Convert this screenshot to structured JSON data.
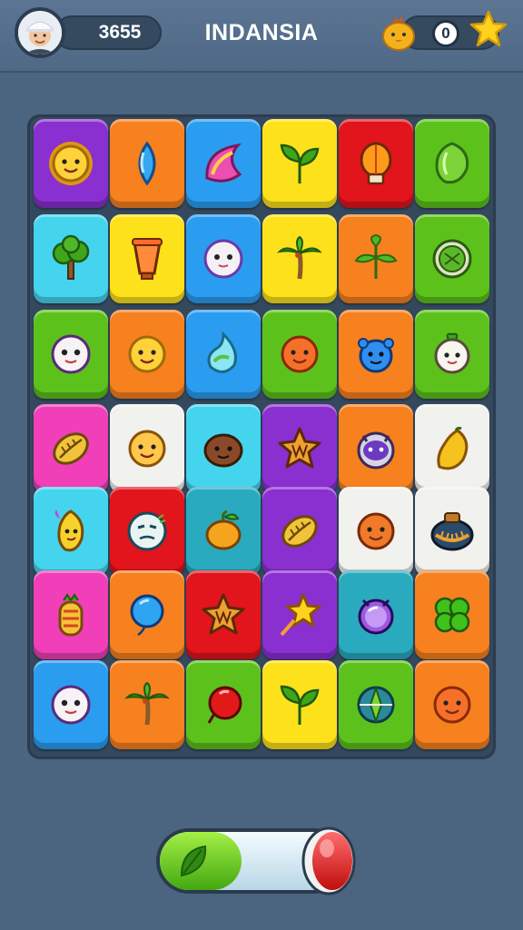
{
  "header": {
    "score": "3655",
    "title": "INDANSIA",
    "lives": "0"
  },
  "colors": {
    "background": "#4b6480",
    "board": "#34485e",
    "purple": "#8a2fd0",
    "orange": "#f7801f",
    "blue": "#2b9df0",
    "yellow": "#fde11a",
    "red": "#e2141c",
    "green": "#5cc21b",
    "cyan": "#44d4ee",
    "pink": "#f03fb8",
    "white": "#f1f1ee",
    "teal": "#29aabf"
  },
  "board": {
    "rows": [
      [
        {
          "color": "purple",
          "icon": "sun-face-icon"
        },
        {
          "color": "orange",
          "icon": "blue-drop-icon"
        },
        {
          "color": "blue",
          "icon": "pink-swirl-icon"
        },
        {
          "color": "yellow",
          "icon": "green-leaf-icon"
        },
        {
          "color": "red",
          "icon": "lantern-icon"
        },
        {
          "color": "green",
          "icon": "green-gem-icon"
        }
      ],
      [
        {
          "color": "cyan",
          "icon": "tree-icon"
        },
        {
          "color": "yellow",
          "icon": "lamp-icon"
        },
        {
          "color": "blue",
          "icon": "ghost-face-icon"
        },
        {
          "color": "yellow",
          "icon": "palm-tree-icon"
        },
        {
          "color": "orange",
          "icon": "leaf-plant-icon"
        },
        {
          "color": "green",
          "icon": "green-ball-icon"
        }
      ],
      [
        {
          "color": "green",
          "icon": "white-face-icon"
        },
        {
          "color": "orange",
          "icon": "yellow-face-icon"
        },
        {
          "color": "blue",
          "icon": "water-swirl-icon"
        },
        {
          "color": "green",
          "icon": "orange-fruit-face-icon"
        },
        {
          "color": "orange",
          "icon": "blue-creature-icon"
        },
        {
          "color": "green",
          "icon": "radish-face-icon"
        }
      ],
      [
        {
          "color": "pink",
          "icon": "seed-icon"
        },
        {
          "color": "white",
          "icon": "chick-face-icon"
        },
        {
          "color": "cyan",
          "icon": "coconut-icon"
        },
        {
          "color": "purple",
          "icon": "star-badge-icon"
        },
        {
          "color": "orange",
          "icon": "purple-robot-icon"
        },
        {
          "color": "white",
          "icon": "mango-icon"
        }
      ],
      [
        {
          "color": "cyan",
          "icon": "pepper-face-icon"
        },
        {
          "color": "red",
          "icon": "mask-face-icon"
        },
        {
          "color": "teal",
          "icon": "mango-fruit-icon"
        },
        {
          "color": "purple",
          "icon": "seed-icon"
        },
        {
          "color": "white",
          "icon": "orange-face-icon"
        },
        {
          "color": "white",
          "icon": "pot-icon"
        }
      ],
      [
        {
          "color": "pink",
          "icon": "pineapple-icon"
        },
        {
          "color": "orange",
          "icon": "blue-balloon-icon"
        },
        {
          "color": "red",
          "icon": "star-badge-icon"
        },
        {
          "color": "purple",
          "icon": "star-wand-icon"
        },
        {
          "color": "teal",
          "icon": "purple-orb-icon"
        },
        {
          "color": "orange",
          "icon": "clover-icon"
        }
      ],
      [
        {
          "color": "blue",
          "icon": "white-face-icon"
        },
        {
          "color": "orange",
          "icon": "palm-tree-icon"
        },
        {
          "color": "green",
          "icon": "red-balloon-icon"
        },
        {
          "color": "yellow",
          "icon": "green-leaf-icon"
        },
        {
          "color": "green",
          "icon": "compass-icon"
        },
        {
          "color": "orange",
          "icon": "orange-fruit-face-icon"
        }
      ]
    ]
  },
  "booster": {
    "progress": 0.45
  }
}
